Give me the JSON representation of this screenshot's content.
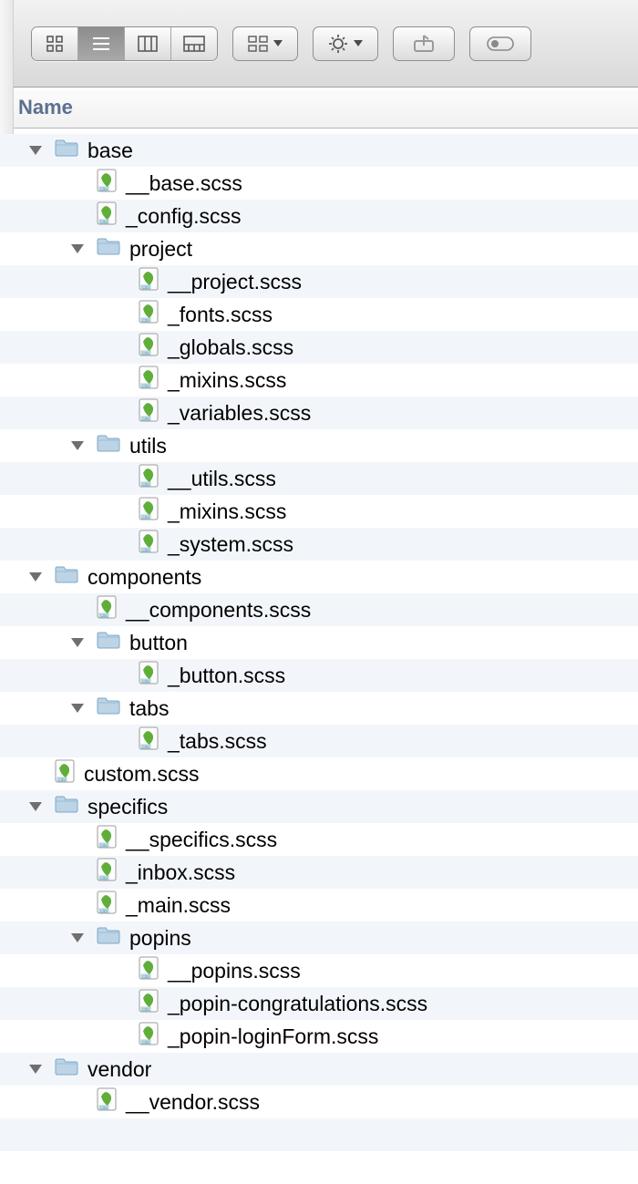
{
  "header": {
    "column_name": "Name"
  },
  "toolbar": {
    "view_icons": "icon-view",
    "view_list": "list-view",
    "view_columns": "column-view",
    "view_coverflow": "coverflow-view",
    "arrange": "arrange",
    "action": "action",
    "share": "share",
    "tags": "tags"
  },
  "tree": [
    {
      "depth": 0,
      "kind": "folder",
      "expanded": true,
      "label": "base"
    },
    {
      "depth": 1,
      "kind": "file",
      "label": "__base.scss"
    },
    {
      "depth": 1,
      "kind": "file",
      "label": "_config.scss"
    },
    {
      "depth": 1,
      "kind": "folder",
      "expanded": true,
      "label": "project"
    },
    {
      "depth": 2,
      "kind": "file",
      "label": "__project.scss"
    },
    {
      "depth": 2,
      "kind": "file",
      "label": "_fonts.scss"
    },
    {
      "depth": 2,
      "kind": "file",
      "label": "_globals.scss"
    },
    {
      "depth": 2,
      "kind": "file",
      "label": "_mixins.scss"
    },
    {
      "depth": 2,
      "kind": "file",
      "label": "_variables.scss"
    },
    {
      "depth": 1,
      "kind": "folder",
      "expanded": true,
      "label": "utils"
    },
    {
      "depth": 2,
      "kind": "file",
      "label": "__utils.scss"
    },
    {
      "depth": 2,
      "kind": "file",
      "label": "_mixins.scss"
    },
    {
      "depth": 2,
      "kind": "file",
      "label": "_system.scss"
    },
    {
      "depth": 0,
      "kind": "folder",
      "expanded": true,
      "label": "components"
    },
    {
      "depth": 1,
      "kind": "file",
      "label": "__components.scss"
    },
    {
      "depth": 1,
      "kind": "folder",
      "expanded": true,
      "label": "button"
    },
    {
      "depth": 2,
      "kind": "file",
      "label": "_button.scss"
    },
    {
      "depth": 1,
      "kind": "folder",
      "expanded": true,
      "label": "tabs"
    },
    {
      "depth": 2,
      "kind": "file",
      "label": "_tabs.scss"
    },
    {
      "depth": 0,
      "kind": "file",
      "label": "custom.scss"
    },
    {
      "depth": 0,
      "kind": "folder",
      "expanded": true,
      "label": "specifics"
    },
    {
      "depth": 1,
      "kind": "file",
      "label": "__specifics.scss"
    },
    {
      "depth": 1,
      "kind": "file",
      "label": "_inbox.scss"
    },
    {
      "depth": 1,
      "kind": "file",
      "label": "_main.scss"
    },
    {
      "depth": 1,
      "kind": "folder",
      "expanded": true,
      "label": "popins"
    },
    {
      "depth": 2,
      "kind": "file",
      "label": "__popins.scss"
    },
    {
      "depth": 2,
      "kind": "file",
      "label": "_popin-congratulations.scss"
    },
    {
      "depth": 2,
      "kind": "file",
      "label": "_popin-loginForm.scss"
    },
    {
      "depth": 0,
      "kind": "folder",
      "expanded": true,
      "label": "vendor"
    },
    {
      "depth": 1,
      "kind": "file",
      "label": "__vendor.scss"
    }
  ]
}
